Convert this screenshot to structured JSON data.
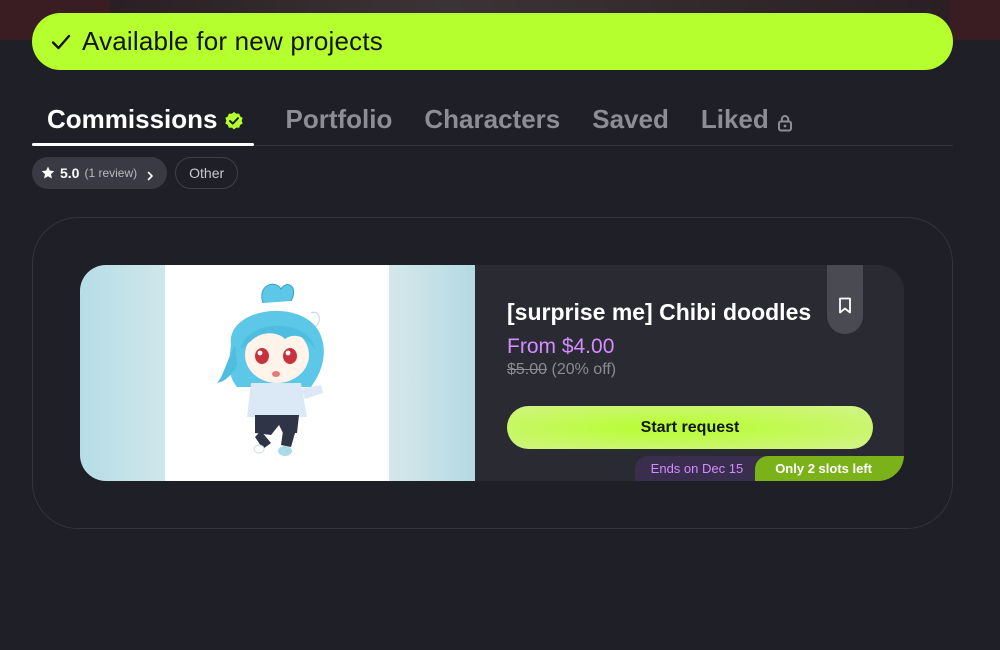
{
  "banner": {
    "icon": "check-icon",
    "text": "Available for new projects",
    "color": "#b6ff2e"
  },
  "tabs": [
    {
      "label": "Commissions",
      "active": true,
      "badge": "verified-check-icon"
    },
    {
      "label": "Portfolio",
      "active": false
    },
    {
      "label": "Characters",
      "active": false
    },
    {
      "label": "Saved",
      "active": false
    },
    {
      "label": "Liked",
      "active": false,
      "badge": "lock-icon"
    }
  ],
  "filters": {
    "rating": {
      "icon": "star-icon",
      "value": "5.0",
      "count": "(1 review)"
    },
    "other_label": "Other"
  },
  "card": {
    "title": "[surprise me] Chibi doodles",
    "price": "From $4.00",
    "original_price": "$5.00",
    "discount": "(20% off)",
    "button_label": "Start request",
    "ends_label": "Ends on Dec 15",
    "slots_label": "Only 2 slots left",
    "image_subject": "chibi character illustration with blue hair",
    "accent_colors": {
      "price": "#d58cff",
      "button": "#b6ff2e",
      "slots_tag": "#7bb21a"
    }
  }
}
